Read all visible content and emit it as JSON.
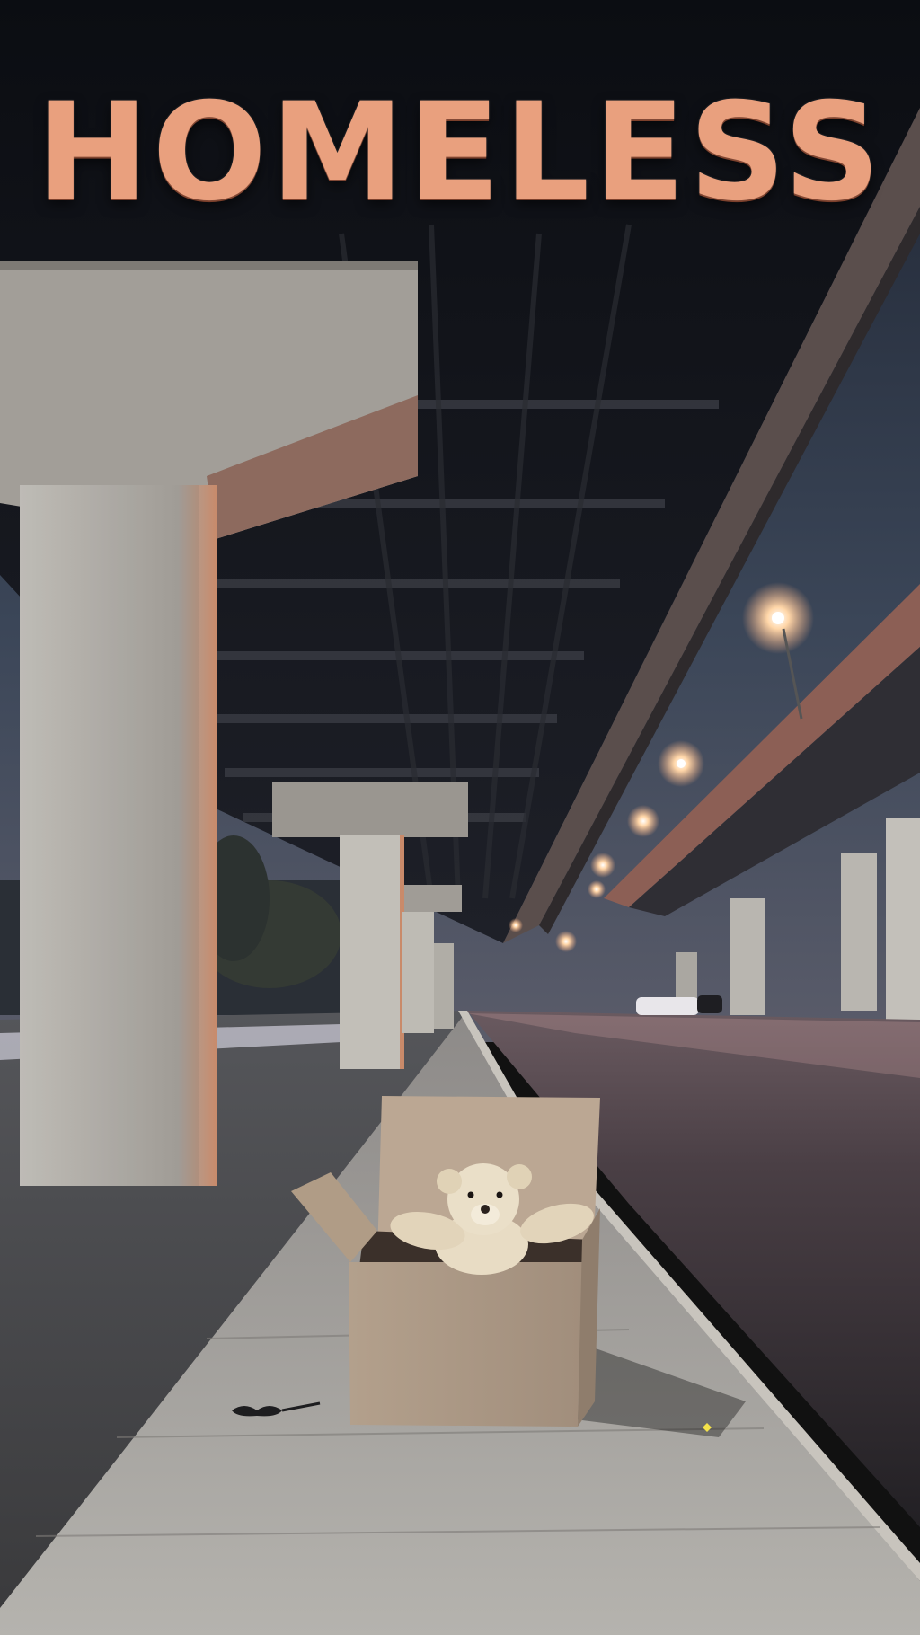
{
  "poster": {
    "title": "HOMELESS"
  },
  "colors": {
    "title": "#e9a07e",
    "sky": "#2b3442",
    "concrete": "#a8a49c",
    "road": "#3a3335",
    "sidewalk": "#9a9690",
    "box": "#b8a48e",
    "lamp_glow": "#ffd0a0"
  }
}
